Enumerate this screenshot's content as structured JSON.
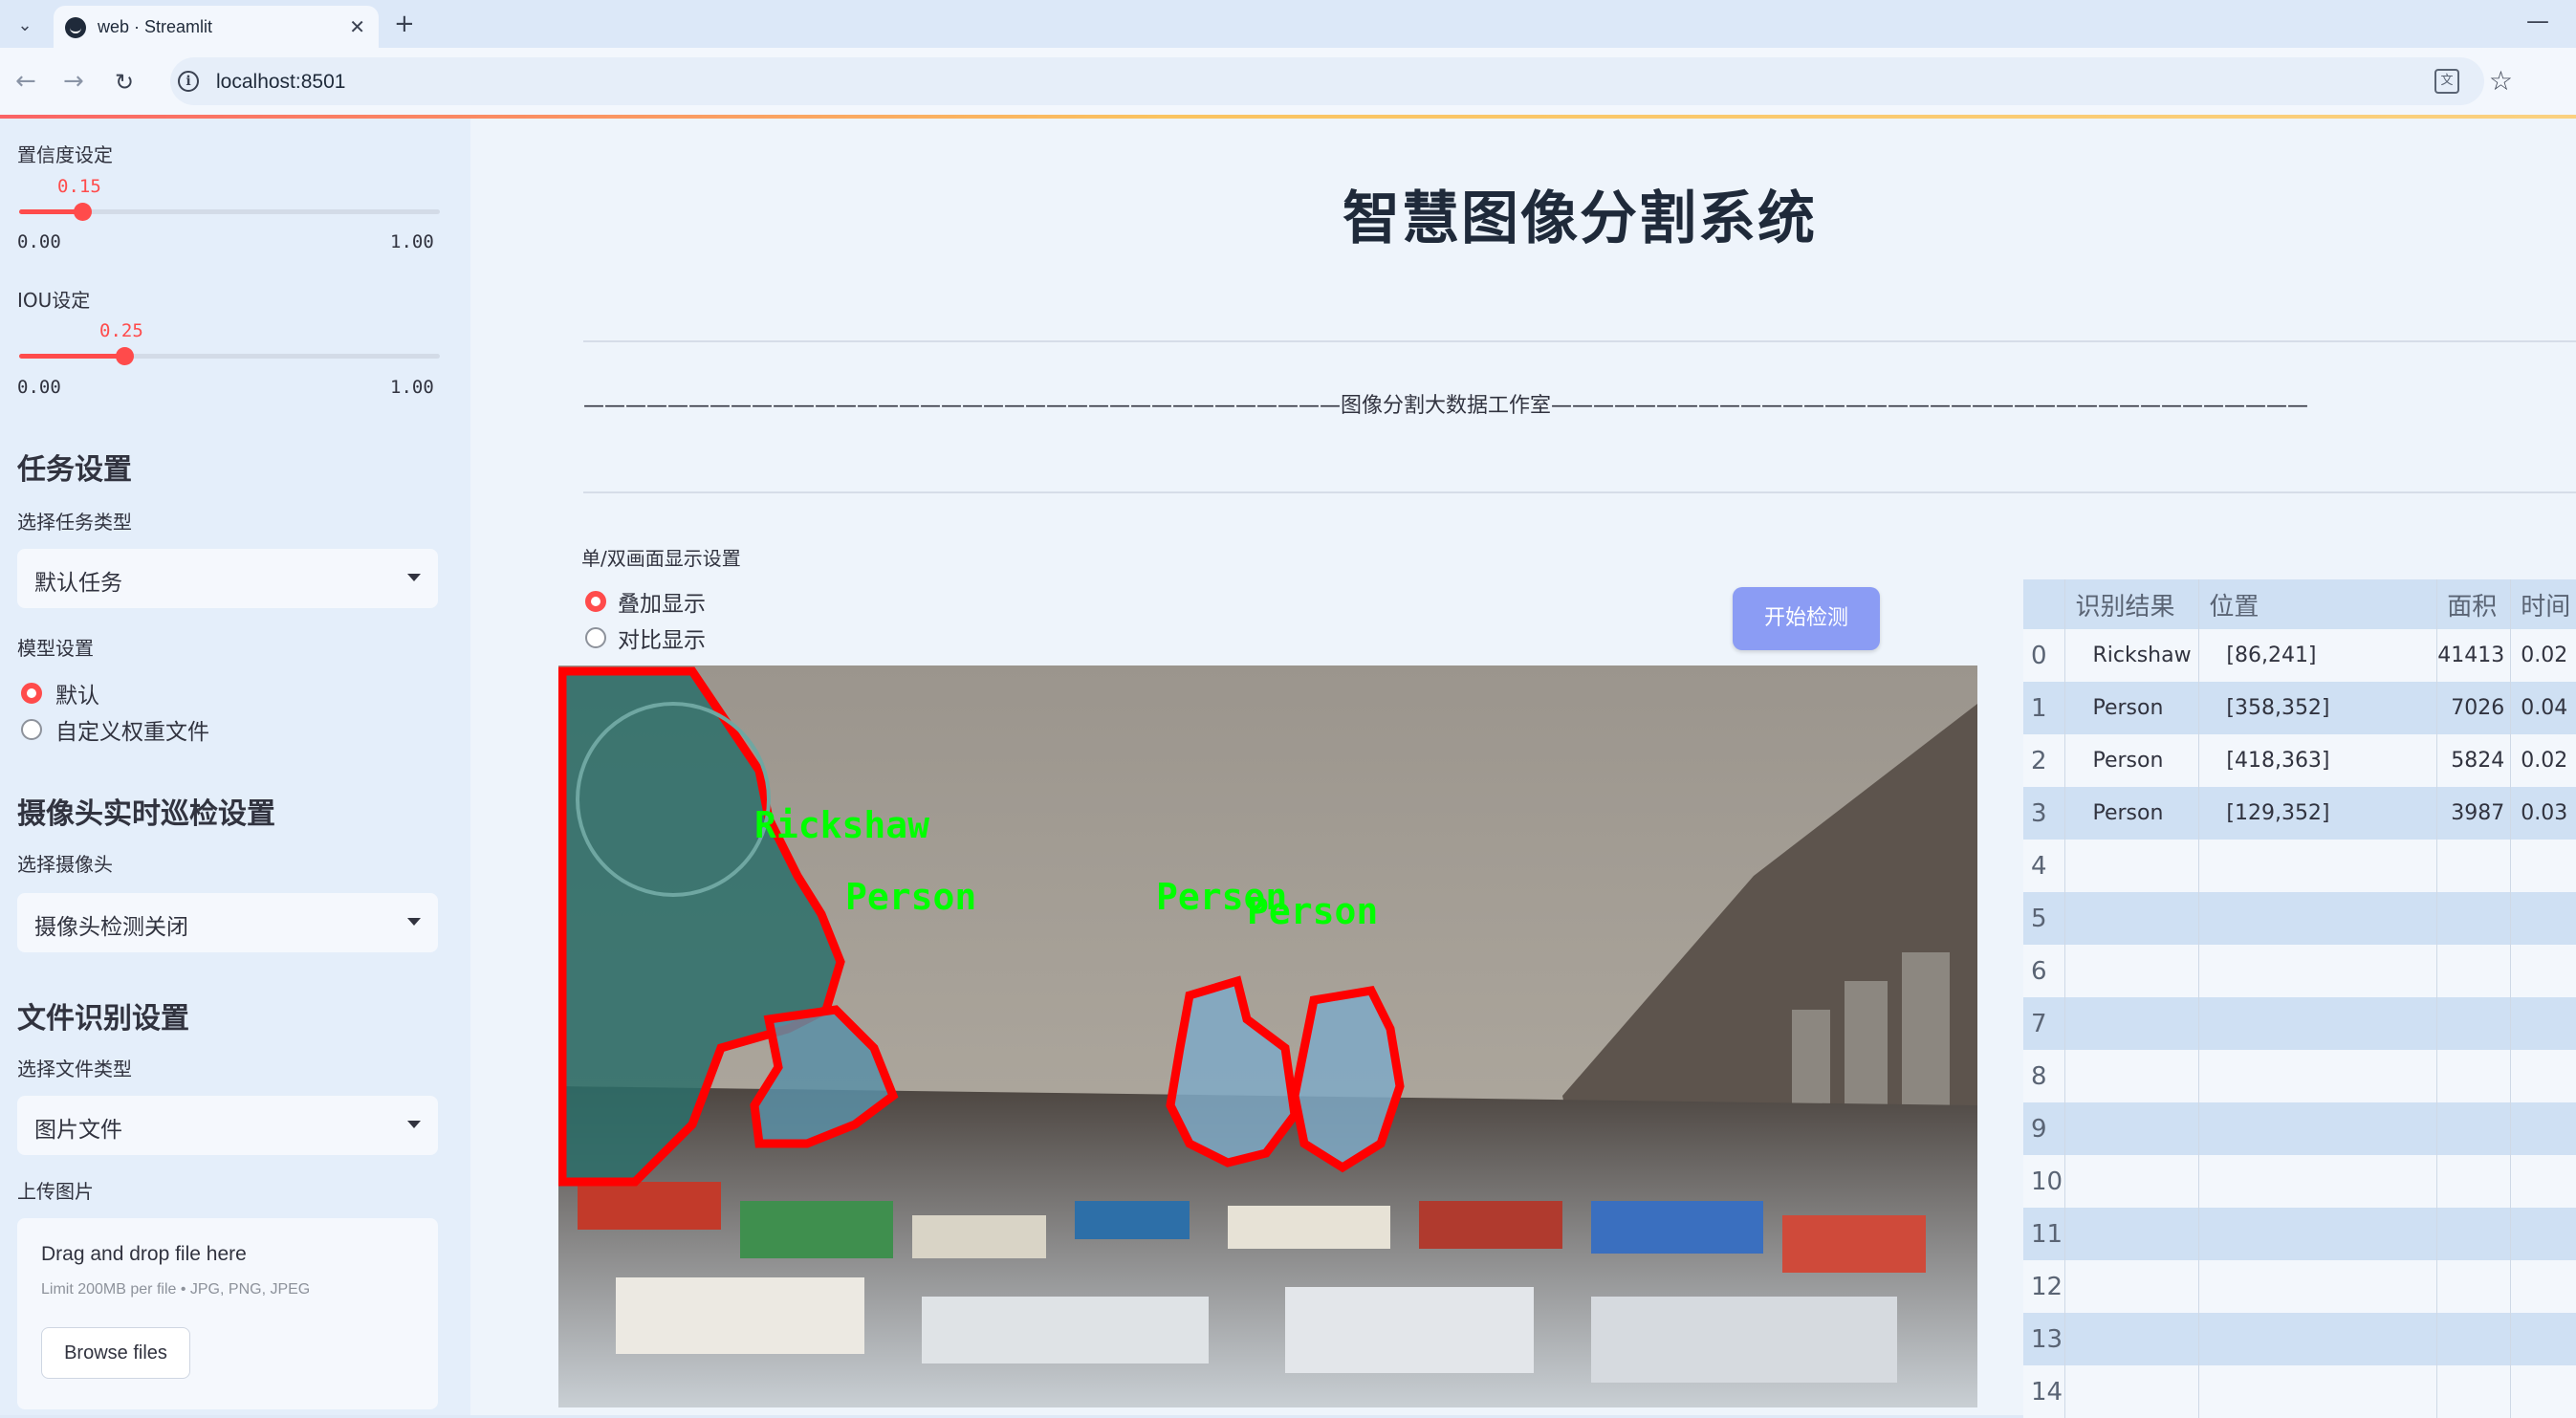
{
  "browser": {
    "tab_title": "web · Streamlit",
    "url": "localhost:8501"
  },
  "sidebar": {
    "confidence": {
      "label": "置信度设定",
      "value": "0.15",
      "min": "0.00",
      "max": "1.00",
      "fraction": 0.15
    },
    "iou": {
      "label": "IOU设定",
      "value": "0.25",
      "min": "0.00",
      "max": "1.00",
      "fraction": 0.25
    },
    "task_heading": "任务设置",
    "task_type_label": "选择任务类型",
    "task_type_value": "默认任务",
    "model_label": "模型设置",
    "model_options": [
      "默认",
      "自定义权重文件"
    ],
    "model_selected": "默认",
    "camera_heading": "摄像头实时巡检设置",
    "camera_label": "选择摄像头",
    "camera_value": "摄像头检测关闭",
    "file_heading": "文件识别设置",
    "file_type_label": "选择文件类型",
    "file_type_value": "图片文件",
    "upload_label": "上传图片",
    "upload_title": "Drag and drop file here",
    "upload_limit": "Limit 200MB per file • JPG, PNG, JPEG",
    "browse_label": "Browse files"
  },
  "main": {
    "title": "智慧图像分割系统",
    "banner": "————————————————————————————————————图像分割大数据工作室————————————————————————————————————",
    "display_label": "单/双画面显示设置",
    "display_options": [
      "叠加显示",
      "对比显示"
    ],
    "display_selected": "叠加显示",
    "start_button": "开始检测",
    "image_labels": [
      "Rickshaw",
      "Person",
      "Person",
      "Person"
    ]
  },
  "table": {
    "headers": [
      "",
      "识别结果",
      "位置",
      "面积",
      "时间"
    ],
    "rows": [
      {
        "idx": "0",
        "name": "Rickshaw",
        "pos": "[86,241]",
        "area": "41413",
        "time": "0.02"
      },
      {
        "idx": "1",
        "name": "Person",
        "pos": "[358,352]",
        "area": "7026",
        "time": "0.04"
      },
      {
        "idx": "2",
        "name": "Person",
        "pos": "[418,363]",
        "area": "5824",
        "time": "0.02"
      },
      {
        "idx": "3",
        "name": "Person",
        "pos": "[129,352]",
        "area": "3987",
        "time": "0.03"
      },
      {
        "idx": "4",
        "name": "",
        "pos": "",
        "area": "",
        "time": ""
      },
      {
        "idx": "5",
        "name": "",
        "pos": "",
        "area": "",
        "time": ""
      },
      {
        "idx": "6",
        "name": "",
        "pos": "",
        "area": "",
        "time": ""
      },
      {
        "idx": "7",
        "name": "",
        "pos": "",
        "area": "",
        "time": ""
      },
      {
        "idx": "8",
        "name": "",
        "pos": "",
        "area": "",
        "time": ""
      },
      {
        "idx": "9",
        "name": "",
        "pos": "",
        "area": "",
        "time": ""
      },
      {
        "idx": "10",
        "name": "",
        "pos": "",
        "area": "",
        "time": ""
      },
      {
        "idx": "11",
        "name": "",
        "pos": "",
        "area": "",
        "time": ""
      },
      {
        "idx": "12",
        "name": "",
        "pos": "",
        "area": "",
        "time": ""
      },
      {
        "idx": "13",
        "name": "",
        "pos": "",
        "area": "",
        "time": ""
      },
      {
        "idx": "14",
        "name": "",
        "pos": "",
        "area": "",
        "time": ""
      }
    ]
  },
  "colors": {
    "accent": "#ff4b4b",
    "button": "#8b9cf4",
    "mask_outline": "#ff0000",
    "label_text": "#00ff00"
  },
  "icons": [
    "tab-menu-icon",
    "streamlit-favicon",
    "close-icon",
    "plus-icon",
    "back-arrow-icon",
    "forward-arrow-icon",
    "reload-icon",
    "info-icon",
    "translate-icon",
    "star-icon",
    "chevron-down-icon"
  ]
}
